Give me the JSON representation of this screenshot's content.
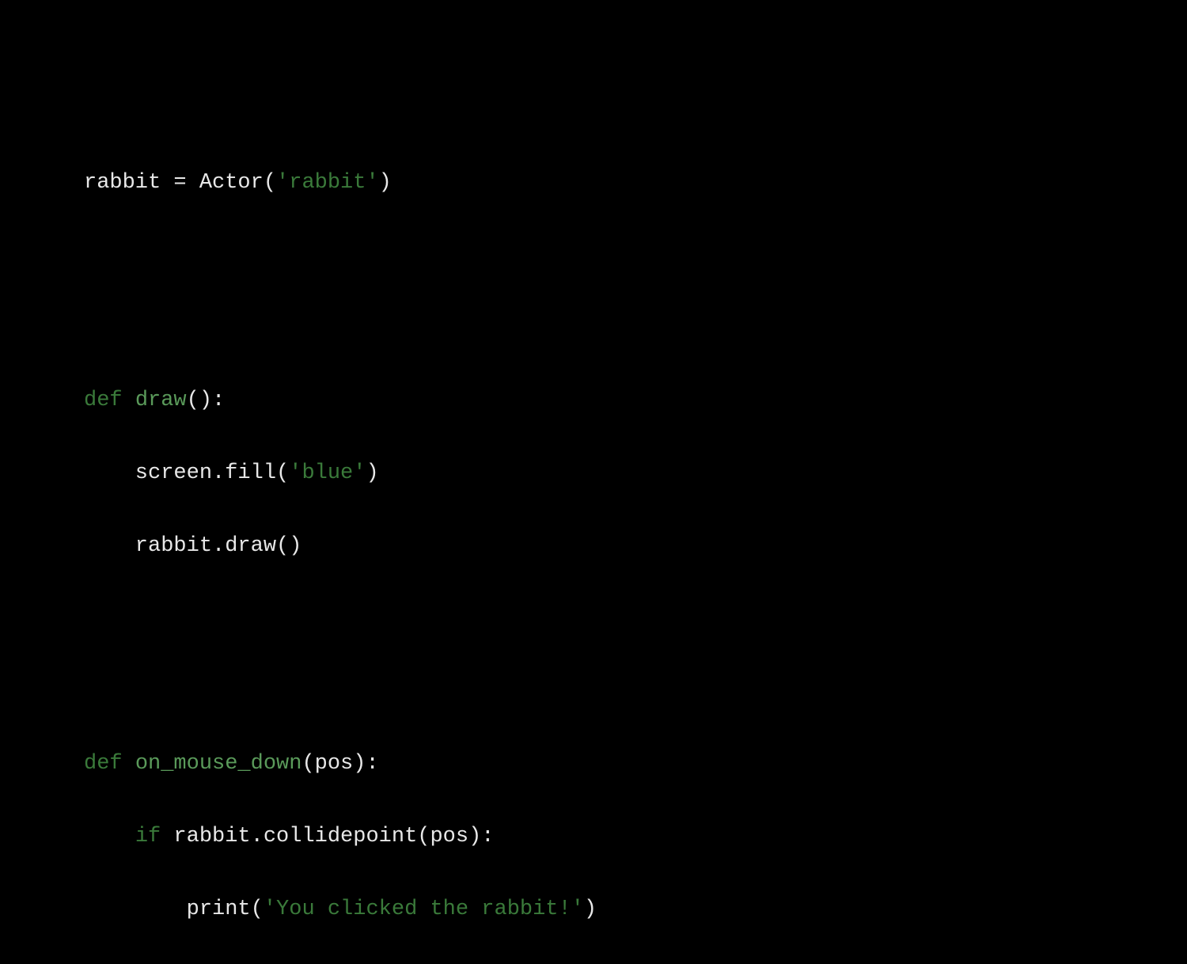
{
  "code": {
    "line1": {
      "t1": "rabbit = Actor(",
      "t2": "'rabbit'",
      "t3": ")"
    },
    "line2": {
      "t1": "def",
      "t2": " ",
      "t3": "draw",
      "t4": "():"
    },
    "line3": {
      "t1": "    screen.fill(",
      "t2": "'blue'",
      "t3": ")"
    },
    "line4": {
      "t1": "    rabbit.draw()"
    },
    "line5": {
      "t1": "def",
      "t2": " ",
      "t3": "on_mouse_down",
      "t4": "(pos):"
    },
    "line6": {
      "t1": "    ",
      "t2": "if",
      "t3": " rabbit.collidepoint(pos):"
    },
    "line7": {
      "t1": "        print(",
      "t2": "'You clicked the rabbit!'",
      "t3": ")"
    }
  }
}
